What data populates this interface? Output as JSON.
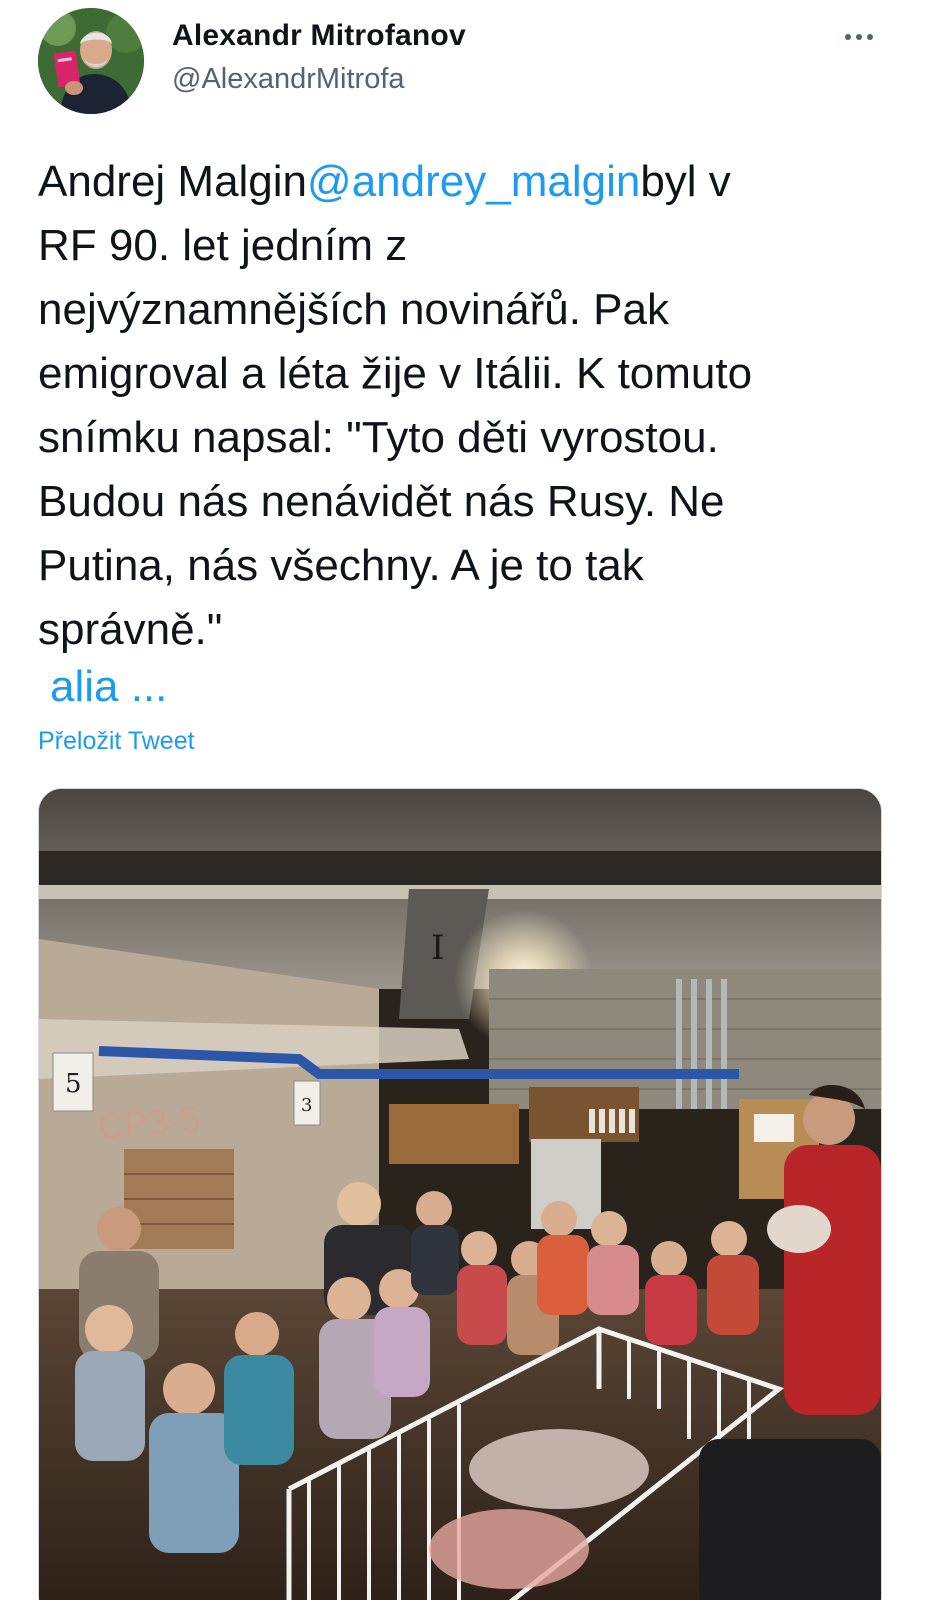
{
  "author": {
    "display_name": "Alexandr Mitrofanov",
    "handle": "@AlexandrMitrofa",
    "avatar_icon": "profile-photo"
  },
  "more_icon": "more-dots-icon",
  "tweet": {
    "lines": [
      {
        "before": "Andrej Malgin",
        "mention": "@andrey_malgin",
        "after": "byl v"
      },
      {
        "text": "RF 90. let jedním z"
      },
      {
        "text": "nejvýznamnějších novinářů. Pak"
      },
      {
        "text": "emigroval a léta žije v Itálii. K tomuto"
      },
      {
        "text": "snímku napsal: \"Tyto děti vyrostou."
      },
      {
        "text": "Budou nás nenávidět nás Rusy. Ne"
      },
      {
        "text": "Putina, nás všechny. A je to tak"
      },
      {
        "text": "správně.\""
      }
    ],
    "more_link": "alia ...",
    "translate_link": "Přeložit Tweet"
  },
  "media": {
    "sign_5": "5",
    "sign_3": "3",
    "wall_graffiti": "СР3-5"
  },
  "colors": {
    "link": "#1d9bf0",
    "text": "#0f1419",
    "secondary": "#536471"
  }
}
